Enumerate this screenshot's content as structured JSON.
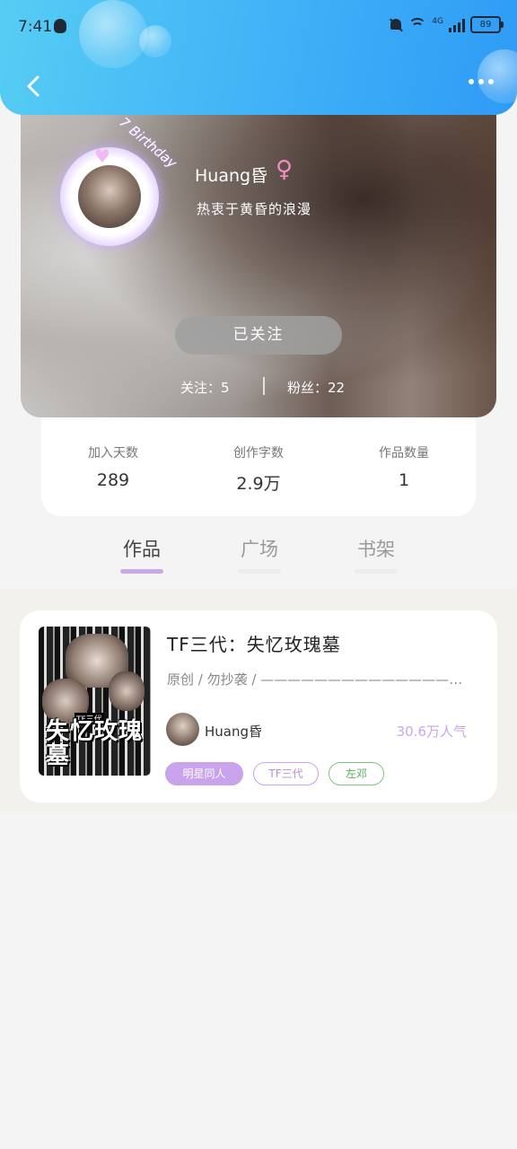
{
  "status_bar": {
    "time": "7:41",
    "network": "4G",
    "battery": "89"
  },
  "profile": {
    "birthday_tag": "7 Birthday",
    "name": "Huang昏",
    "gender_symbol": "♀",
    "bio": "热衷于黄昏的浪漫",
    "follow_button": "已关注",
    "following": "关注：5",
    "fans": "粉丝：22"
  },
  "stats": [
    {
      "label": "加入天数",
      "value": "289"
    },
    {
      "label": "创作字数",
      "value": "2.9万"
    },
    {
      "label": "作品数量",
      "value": "1"
    }
  ],
  "tabs": [
    {
      "label": "作品"
    },
    {
      "label": "广场"
    },
    {
      "label": "书架"
    }
  ],
  "book": {
    "cover_title": "失忆玫瑰墓",
    "cover_sub": "TF三代",
    "title": "TF三代：失忆玫瑰墓",
    "description": "原创 / 勿抄袭 / ——————————————————",
    "author": "Huang昏",
    "popularity": "30.6万人气",
    "tags": [
      "明星同人",
      "TF三代",
      "左邓"
    ]
  },
  "colors": {
    "header": "#3fb1f7",
    "accent_purple": "#c9a3ec",
    "tag_green": "#7dc57d"
  }
}
